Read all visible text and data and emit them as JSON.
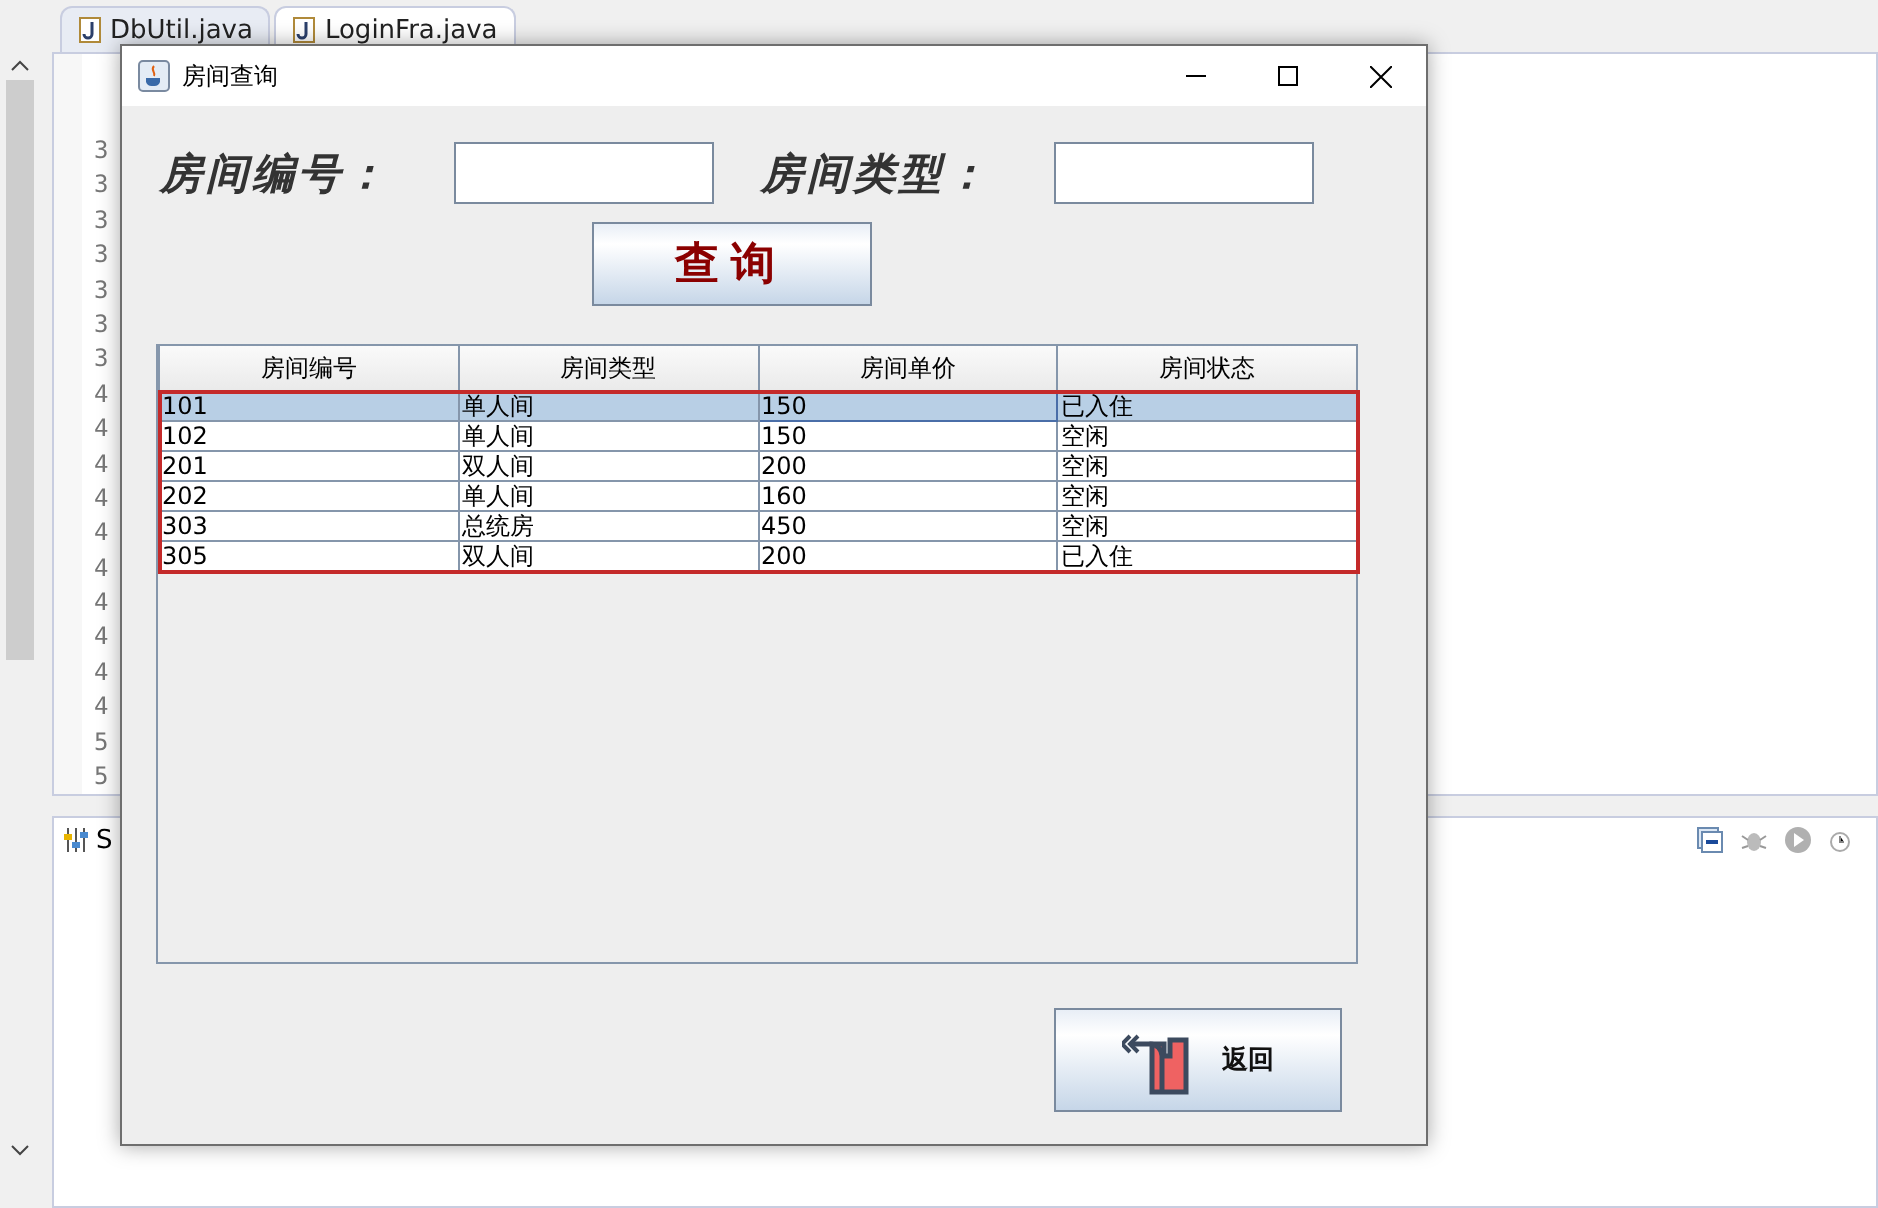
{
  "ide": {
    "tabs": [
      {
        "label": "DbUtil.java",
        "selected": false
      },
      {
        "label": "LoginFra.java",
        "selected": true
      }
    ],
    "line_numbers": [
      "3",
      "3",
      "3",
      "3",
      "3",
      "3",
      "3",
      "4",
      "4",
      "4",
      "4",
      "4",
      "4",
      "4",
      "4",
      "4",
      "4",
      "5",
      "5"
    ],
    "panel_tab": "S"
  },
  "dialog": {
    "title": "房间查询",
    "fields": [
      {
        "label": "房间编号："
      },
      {
        "label": "房间类型："
      }
    ],
    "search_button": "查询",
    "table": {
      "columns": [
        "房间编号",
        "房间类型",
        "房间单价",
        "房间状态"
      ],
      "rows": [
        {
          "cells": [
            "101",
            "单人间",
            "150",
            "已入住"
          ],
          "selected": true
        },
        {
          "cells": [
            "102",
            "单人间",
            "150",
            "空闲"
          ],
          "selected": false
        },
        {
          "cells": [
            "201",
            "双人间",
            "200",
            "空闲"
          ],
          "selected": false
        },
        {
          "cells": [
            "202",
            "单人间",
            "160",
            "空闲"
          ],
          "selected": false
        },
        {
          "cells": [
            "303",
            "总统房",
            "450",
            "空闲"
          ],
          "selected": false
        },
        {
          "cells": [
            "305",
            "双人间",
            "200",
            "已入住"
          ],
          "selected": false
        }
      ]
    },
    "back_button": "返回"
  }
}
